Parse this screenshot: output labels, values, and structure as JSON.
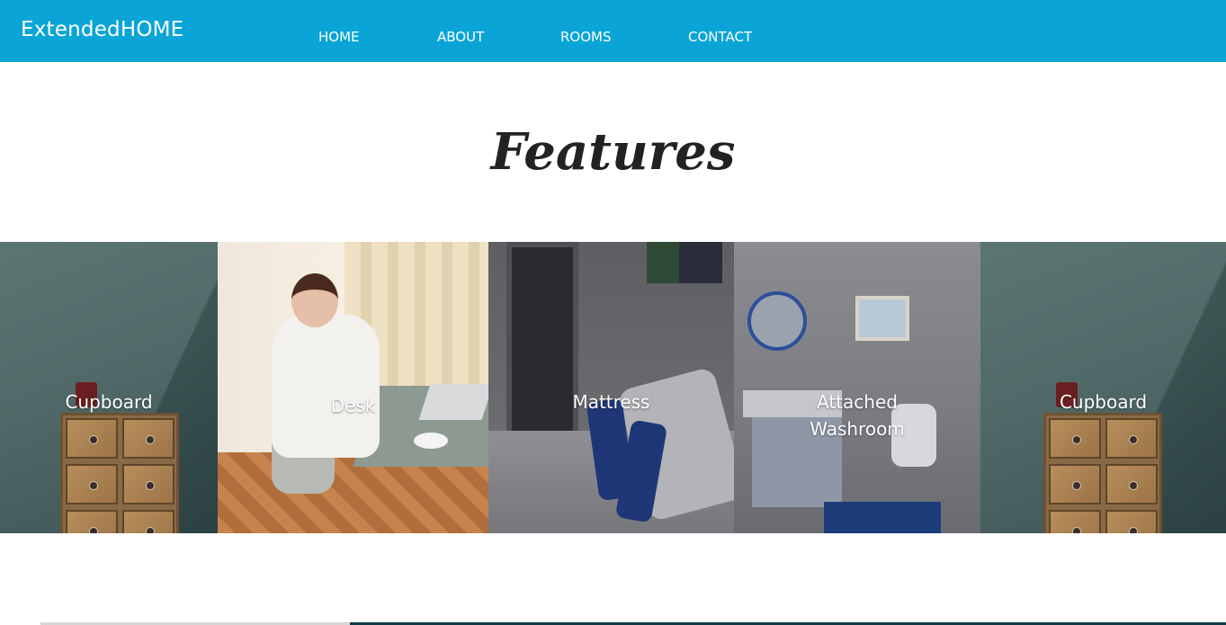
{
  "brand": "ExtendedHOME",
  "nav": {
    "items": [
      {
        "label": "HOME"
      },
      {
        "label": "ABOUT"
      },
      {
        "label": "ROOMS"
      },
      {
        "label": "CONTACT"
      }
    ]
  },
  "features": {
    "title": "Features",
    "tiles": [
      {
        "label": "Cupboard"
      },
      {
        "label": "Desk"
      },
      {
        "label": "Mattress"
      },
      {
        "label": "Attached Washroom",
        "line1": "Attached",
        "line2": "Washroom"
      },
      {
        "label": "Cupboard"
      }
    ]
  },
  "colors": {
    "navbar": "#0aa5d6",
    "nav_text": "#ffffff",
    "title_text": "#222222"
  }
}
